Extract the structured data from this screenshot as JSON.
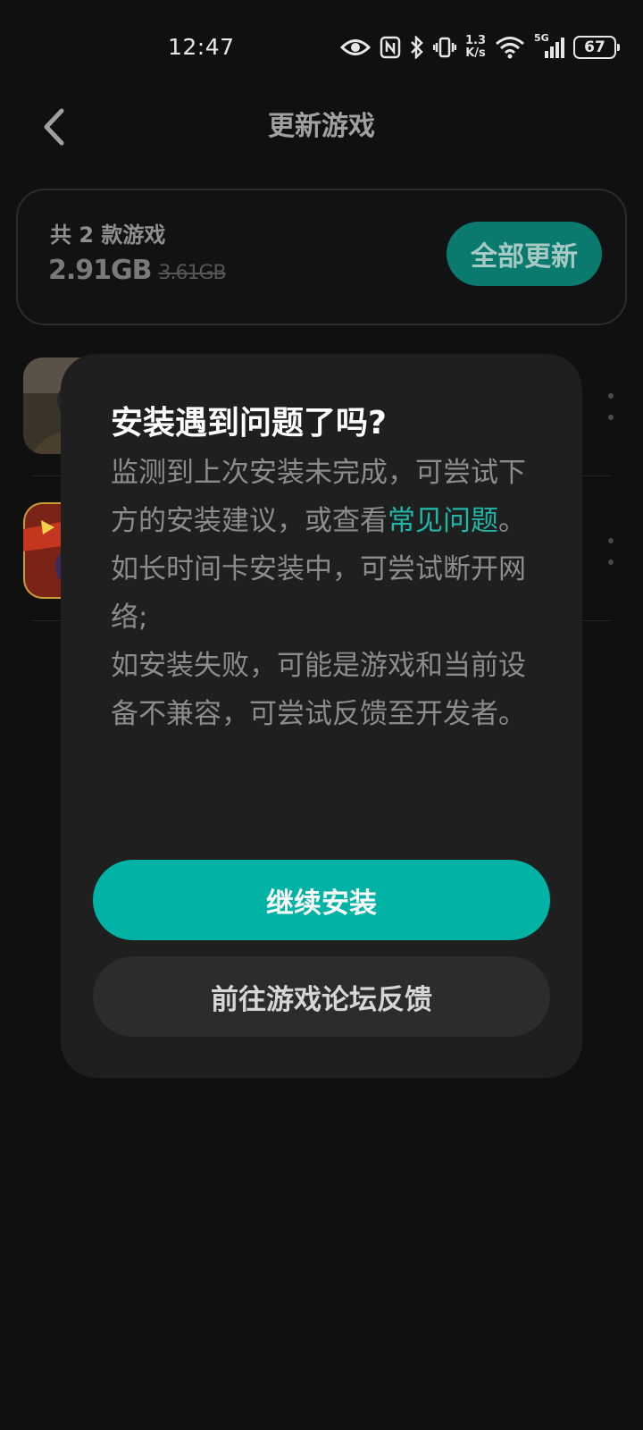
{
  "status_bar": {
    "time": "12:47",
    "net_speed_value": "1.3",
    "net_speed_unit": "K/s",
    "network_type": "5G",
    "battery": "67",
    "icons": [
      "eye-icon",
      "nfc-icon",
      "bluetooth-icon",
      "vibrate-icon",
      "wifi-icon",
      "signal-icon",
      "battery-icon"
    ]
  },
  "header": {
    "title": "更新游戏",
    "back_icon": "chevron-left-icon"
  },
  "summary": {
    "count_text": "共 2 款游戏",
    "size_new": "2.91GB",
    "size_old": "3.61GB",
    "update_all_label": "全部更新"
  },
  "games": [
    {
      "icon": "game-icon-warrior",
      "more_icon": "more-vertical-icon"
    },
    {
      "icon": "game-icon-heroes",
      "more_icon": "more-vertical-icon"
    }
  ],
  "dialog": {
    "title": "安装遇到问题了吗?",
    "body_p1_prefix": "监测到上次安装未完成，可尝试下方的安装建议，或查看",
    "body_p1_link": "常见问题",
    "body_p1_suffix": "。",
    "body_p2": "如长时间卡安装中，可尝试断开网络;",
    "body_p3": "如安装失败，可能是游戏和当前设备不兼容，可尝试反馈至开发者。",
    "primary_button": "继续安装",
    "secondary_button": "前往游戏论坛反馈"
  },
  "colors": {
    "background": "#101010",
    "accent": "#00b3a4",
    "link": "#1fb8a8",
    "dialog_bg": "#1f1f1f"
  }
}
